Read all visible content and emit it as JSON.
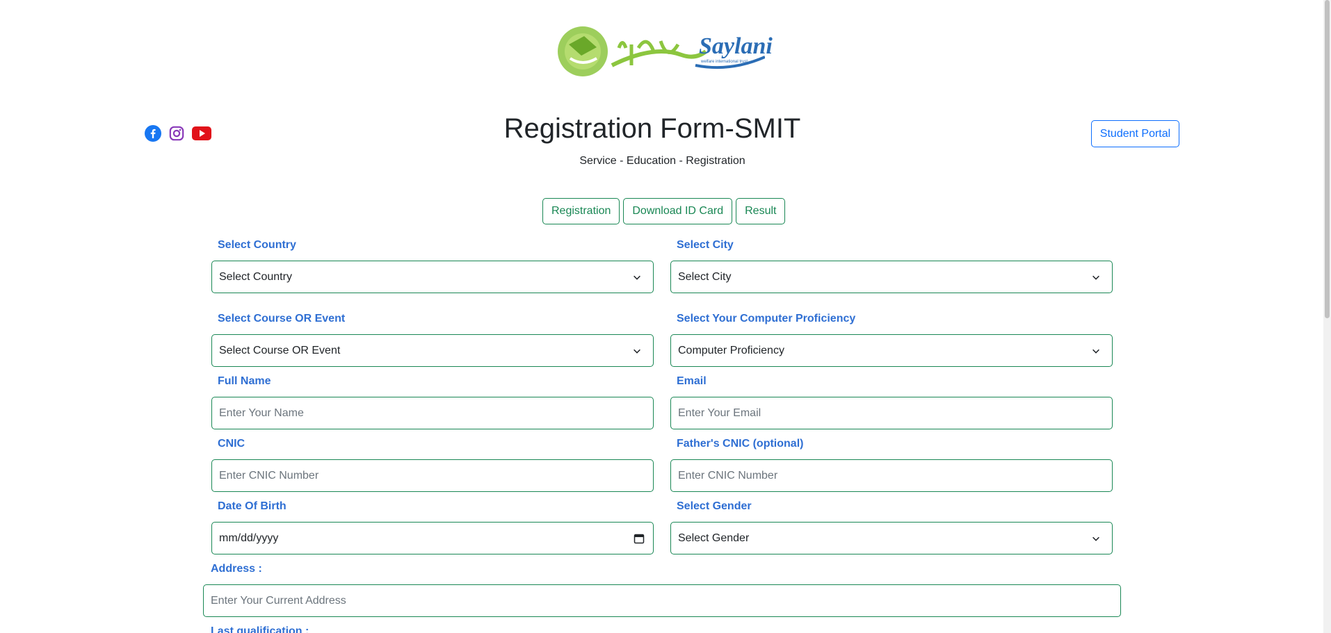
{
  "header": {
    "logo_text": "Saylani",
    "logo_subtext": "welfare international trust",
    "title": "Registration Form-SMIT",
    "subtitle": "Service - Education - Registration",
    "portal_button": "Student Portal"
  },
  "social": [
    "facebook-icon",
    "instagram-icon",
    "youtube-icon"
  ],
  "tabs": [
    {
      "label": "Registration"
    },
    {
      "label": "Download ID Card"
    },
    {
      "label": "Result"
    }
  ],
  "form": {
    "country": {
      "label": "Select Country",
      "value": "Select Country"
    },
    "city": {
      "label": "Select City",
      "value": "Select City"
    },
    "course": {
      "label": "Select Course OR Event",
      "value": "Select Course OR Event"
    },
    "proficiency": {
      "label": "Select Your Computer Proficiency",
      "value": "Computer Proficiency"
    },
    "full_name": {
      "label": "Full Name",
      "placeholder": "Enter Your Name"
    },
    "email": {
      "label": "Email",
      "placeholder": "Enter Your Email"
    },
    "cnic": {
      "label": "CNIC",
      "placeholder": "Enter CNIC Number"
    },
    "father_cnic": {
      "label": "Father's CNIC (optional)",
      "placeholder": "Enter CNIC Number"
    },
    "dob": {
      "label": "Date Of Birth",
      "placeholder": "mm/dd/yyyy"
    },
    "gender": {
      "label": "Select Gender",
      "value": "Select Gender"
    },
    "address": {
      "label": "Address :",
      "placeholder": "Enter Your Current Address"
    },
    "qualification": {
      "label": "Last qualification :"
    }
  },
  "colors": {
    "accent_green": "#198754",
    "label_blue": "#2f6fd3",
    "button_blue": "#0d6efd"
  }
}
